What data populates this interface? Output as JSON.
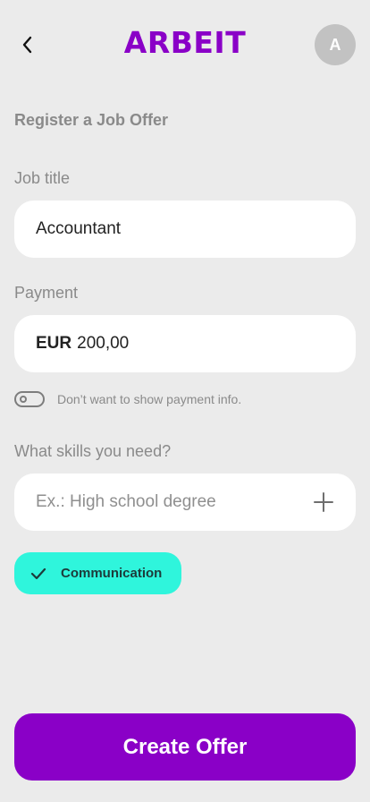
{
  "header": {
    "logo": "ARBEIT",
    "avatar_initial": "A",
    "back_icon": "chevron-left-icon"
  },
  "page": {
    "title": "Register a Job Offer"
  },
  "job_title": {
    "label": "Job title",
    "value": "Accountant"
  },
  "payment": {
    "label": "Payment",
    "currency": "EUR",
    "amount": "200,00",
    "hide_toggle": {
      "label": "Don’t want to show payment info.",
      "checked": false
    }
  },
  "skills": {
    "label": "What skills you need?",
    "placeholder": "Ex.: High school degree",
    "add_icon": "plus-icon",
    "selected": [
      {
        "label": "Communication",
        "icon": "check-icon"
      }
    ]
  },
  "actions": {
    "create_label": "Create Offer"
  },
  "colors": {
    "brand": "#8a00c7",
    "chip": "#2ff5dc",
    "background": "#ebebeb"
  }
}
